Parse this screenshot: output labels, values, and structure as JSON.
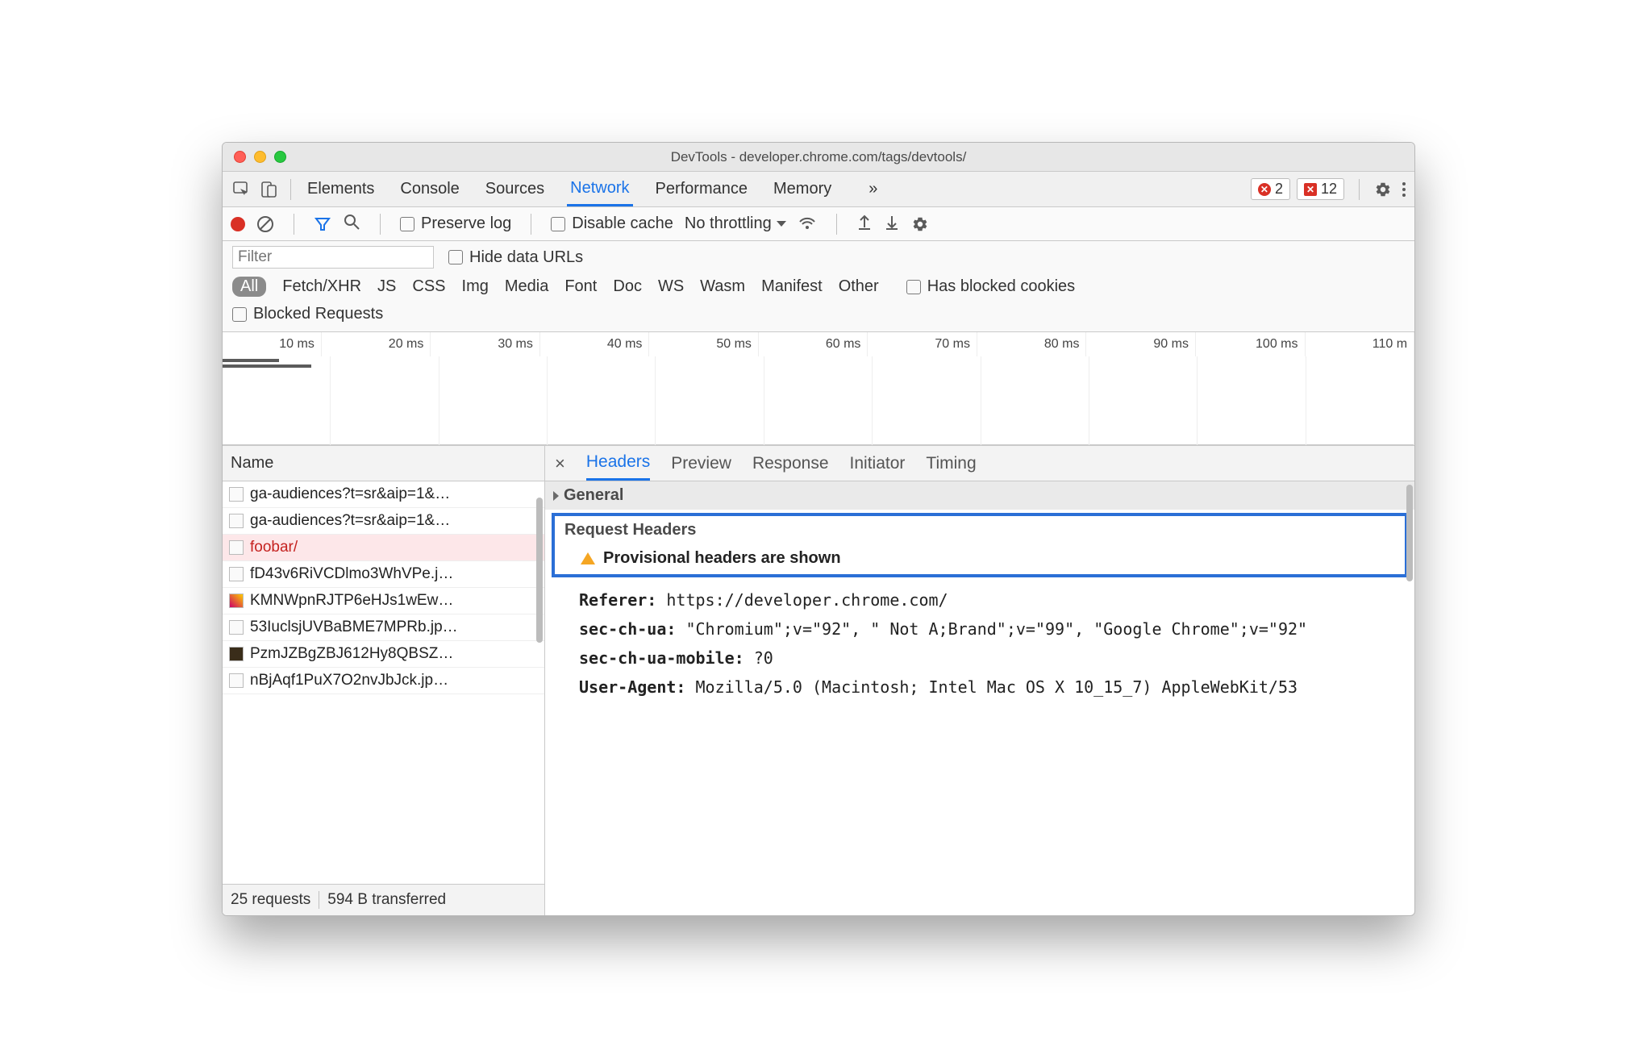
{
  "window": {
    "title": "DevTools - developer.chrome.com/tags/devtools/"
  },
  "tabs": {
    "items": [
      "Elements",
      "Console",
      "Sources",
      "Network",
      "Performance",
      "Memory"
    ],
    "active": "Network"
  },
  "badges": {
    "errors_circle": "2",
    "errors_square": "12"
  },
  "toolbar": {
    "preserve_log": "Preserve log",
    "disable_cache": "Disable cache",
    "throttling": "No throttling"
  },
  "filter": {
    "placeholder": "Filter",
    "hide_urls": "Hide data URLs",
    "types": [
      "All",
      "Fetch/XHR",
      "JS",
      "CSS",
      "Img",
      "Media",
      "Font",
      "Doc",
      "WS",
      "Wasm",
      "Manifest",
      "Other"
    ],
    "blocked_cookies": "Has blocked cookies",
    "blocked_requests": "Blocked Requests"
  },
  "timeline": {
    "ticks": [
      "10 ms",
      "20 ms",
      "30 ms",
      "40 ms",
      "50 ms",
      "60 ms",
      "70 ms",
      "80 ms",
      "90 ms",
      "100 ms",
      "110 m"
    ]
  },
  "list": {
    "header": "Name",
    "rows": [
      {
        "label": "ga-audiences?t=sr&aip=1&…",
        "cls": ""
      },
      {
        "label": "ga-audiences?t=sr&aip=1&…",
        "cls": ""
      },
      {
        "label": "foobar/",
        "cls": "error"
      },
      {
        "label": "fD43v6RiVCDlmo3WhVPe.j…",
        "cls": ""
      },
      {
        "label": "KMNWpnRJTP6eHJs1wEw…",
        "cls": "pic"
      },
      {
        "label": "53IuclsjUVBaBME7MPRb.jp…",
        "cls": ""
      },
      {
        "label": "PzmJZBgZBJ612Hy8QBSZ…",
        "cls": "dark"
      },
      {
        "label": "nBjAqf1PuX7O2nvJbJck.jp…",
        "cls": ""
      }
    ],
    "footer": {
      "requests": "25 requests",
      "transferred": "594 B transferred"
    }
  },
  "detail": {
    "tabs": [
      "Headers",
      "Preview",
      "Response",
      "Initiator",
      "Timing"
    ],
    "active": "Headers",
    "general": "General",
    "request_headers": "Request Headers",
    "provisional": "Provisional headers are shown",
    "headers": [
      {
        "k": "Referer:",
        "v": "https://developer.chrome.com/"
      },
      {
        "k": "sec-ch-ua:",
        "v": "\"Chromium\";v=\"92\", \" Not A;Brand\";v=\"99\", \"Google Chrome\";v=\"92\""
      },
      {
        "k": "sec-ch-ua-mobile:",
        "v": "?0"
      },
      {
        "k": "User-Agent:",
        "v": "Mozilla/5.0 (Macintosh; Intel Mac OS X 10_15_7) AppleWebKit/53"
      }
    ]
  }
}
